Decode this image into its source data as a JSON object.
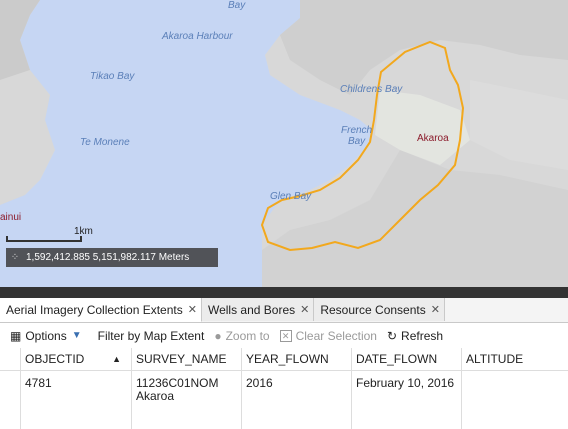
{
  "map": {
    "labels": {
      "bay_top": "Bay",
      "akaroa_harbour": "Akaroa Harbour",
      "tikao_bay": "Tikao Bay",
      "te_monene": "Te Monene",
      "childrens_bay": "Childrens Bay",
      "french_bay": "French\nBay",
      "akaroa": "Akaroa",
      "glen_bay": "Glen Bay",
      "wainui_partial": "ainui"
    },
    "scale_label": "1km",
    "coordinates": "1,592,412.885 5,151,982.117 Meters",
    "colors": {
      "water": "#c6d6f3",
      "land": "#d9d9d9",
      "boundary": "#f2a81d"
    }
  },
  "tabs": [
    {
      "label": "Aerial Imagery Collection Extents",
      "active": true
    },
    {
      "label": "Wells and Bores",
      "active": false
    },
    {
      "label": "Resource Consents",
      "active": false
    }
  ],
  "toolbar": {
    "options": "Options",
    "filter": "Filter by Map Extent",
    "zoom": "Zoom to",
    "clear": "Clear Selection",
    "refresh": "Refresh"
  },
  "table": {
    "columns": [
      "OBJECTID",
      "SURVEY_NAME",
      "YEAR_FLOWN",
      "DATE_FLOWN",
      "ALTITUDE"
    ],
    "rows": [
      {
        "objectid": "4781",
        "survey_name_1": "11236C01NOM",
        "survey_name_2": "Akaroa",
        "year_flown": "2016",
        "date_flown": "February 10, 2016",
        "altitude": ""
      }
    ]
  }
}
